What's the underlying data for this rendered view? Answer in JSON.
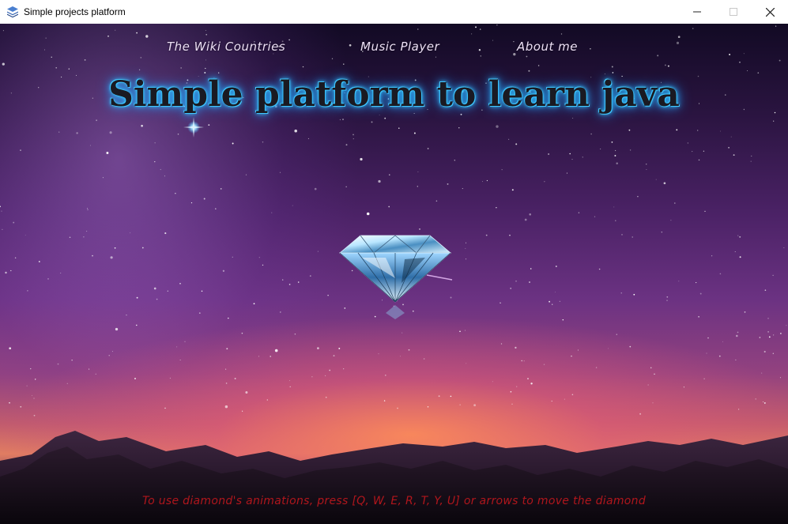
{
  "window": {
    "title": "Simple projects platform",
    "icon": "stacked-layers-icon",
    "controls": {
      "minimize": "—",
      "maximize": "☐",
      "close": "✕"
    }
  },
  "nav": {
    "items": [
      {
        "label": "The Wiki Countries"
      },
      {
        "label": "Music Player"
      },
      {
        "label": "About me"
      }
    ]
  },
  "headline": "Simple platform to learn java",
  "hint": "To use diamond's animations, press [Q, W, E, R, T, Y, U] or arrows to move the diamond",
  "colors": {
    "headline_glow": "#2bb5ff",
    "hint_text": "#b0161c",
    "nav_text": "#ecdff5"
  }
}
